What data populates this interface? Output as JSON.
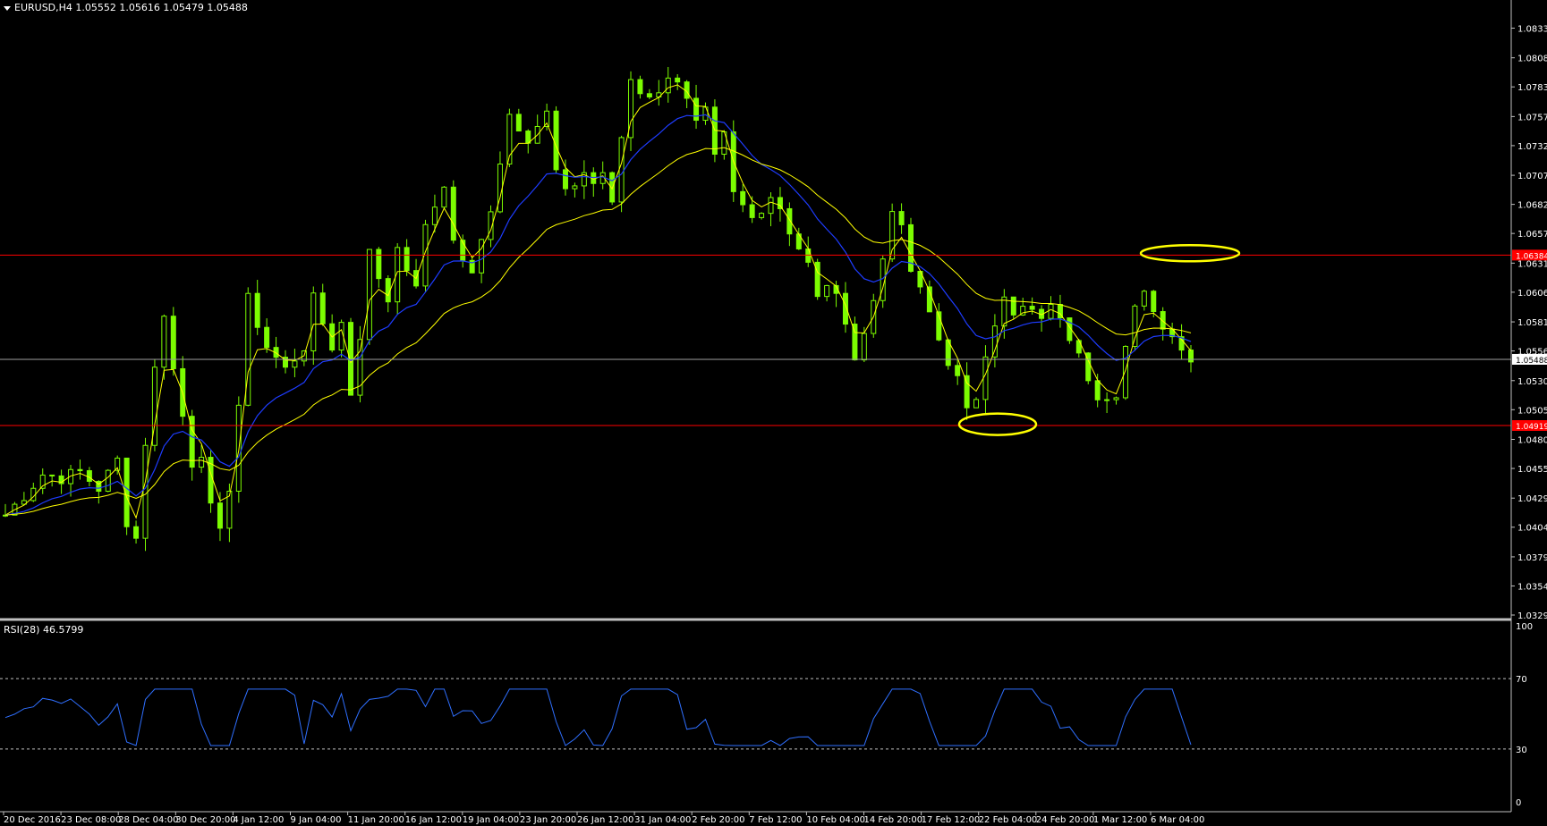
{
  "header": {
    "symbol": "EURUSD,H4",
    "open": "1.05552",
    "high": "1.05616",
    "low": "1.05479",
    "close": "1.05488"
  },
  "rsi_label": "RSI(28) 46.5799",
  "colors": {
    "background": "#000000",
    "candles": "#7cfc00",
    "ma_fast": "#ffff00",
    "ma_mid": "#1e3cff",
    "ma_slow": "#ffff00",
    "hline": "#ff0000",
    "price_line": "#a0a0a0",
    "rsi": "#2f6fff",
    "ellipse": "#ffff00"
  },
  "chart_data": [
    {
      "type": "candlestick",
      "title": "EURUSD,H4",
      "ylim": [
        1.0329,
        1.085
      ],
      "y_ticks": [
        "1.08335",
        "1.08080",
        "1.07830",
        "1.07575",
        "1.07325",
        "1.07070",
        "1.06820",
        "1.06570",
        "1.06315",
        "1.06065",
        "1.05810",
        "1.05560",
        "1.05305",
        "1.05055",
        "1.04800",
        "1.04550",
        "1.04295",
        "1.04045",
        "1.03790",
        "1.03540",
        "1.03290"
      ],
      "x_ticks": [
        "20 Dec 2016",
        "23 Dec 08:00",
        "28 Dec 04:00",
        "30 Dec 20:00",
        "4 Jan 12:00",
        "9 Jan 04:00",
        "11 Jan 20:00",
        "16 Jan 12:00",
        "19 Jan 04:00",
        "23 Jan 20:00",
        "26 Jan 12:00",
        "31 Jan 04:00",
        "2 Feb 20:00",
        "7 Feb 12:00",
        "10 Feb 04:00",
        "14 Feb 20:00",
        "17 Feb 12:00",
        "22 Feb 04:00",
        "24 Feb 20:00",
        "1 Mar 12:00",
        "6 Mar 04:00"
      ],
      "close_price_label": "1.05488",
      "close_price": 1.05488,
      "horizontal_lines": [
        {
          "value": 1.06384,
          "label": "1.06384"
        },
        {
          "value": 1.04919,
          "label": "1.04919"
        }
      ],
      "close_path": [
        [
          0,
          1.0415
        ],
        [
          2,
          1.0432
        ],
        [
          4,
          1.045
        ],
        [
          6,
          1.0447
        ],
        [
          8,
          1.0452
        ],
        [
          10,
          1.0438
        ],
        [
          12,
          1.0462
        ],
        [
          13,
          1.041
        ],
        [
          14,
          1.0395
        ],
        [
          15,
          1.0478
        ],
        [
          16,
          1.054
        ],
        [
          17,
          1.059
        ],
        [
          18,
          1.054
        ],
        [
          20,
          1.046
        ],
        [
          21,
          1.047
        ],
        [
          22,
          1.042
        ],
        [
          23,
          1.0398
        ],
        [
          24,
          1.044
        ],
        [
          25,
          1.051
        ],
        [
          26,
          1.06
        ],
        [
          28,
          1.056
        ],
        [
          30,
          1.054
        ],
        [
          32,
          1.056
        ],
        [
          33,
          1.06
        ],
        [
          35,
          1.056
        ],
        [
          36,
          1.058
        ],
        [
          37,
          1.052
        ],
        [
          38,
          1.057
        ],
        [
          39,
          1.064
        ],
        [
          41,
          1.06
        ],
        [
          42,
          1.065
        ],
        [
          43,
          1.062
        ],
        [
          44,
          1.0615
        ],
        [
          45,
          1.066
        ],
        [
          47,
          1.07
        ],
        [
          48,
          1.065
        ],
        [
          50,
          1.062
        ],
        [
          52,
          1.068
        ],
        [
          53,
          1.072
        ],
        [
          54,
          1.076
        ],
        [
          56,
          1.074
        ],
        [
          57,
          1.075
        ],
        [
          58,
          1.076
        ],
        [
          59,
          1.071
        ],
        [
          60,
          1.069
        ],
        [
          62,
          1.071
        ],
        [
          63,
          1.07
        ],
        [
          64,
          1.071
        ],
        [
          65,
          1.068
        ],
        [
          66,
          1.074
        ],
        [
          67,
          1.079
        ],
        [
          68,
          1.078
        ],
        [
          70,
          1.0775
        ],
        [
          71,
          1.0795
        ],
        [
          72,
          1.079
        ],
        [
          73,
          1.077
        ],
        [
          74,
          1.075
        ],
        [
          75,
          1.076
        ],
        [
          76,
          1.072
        ],
        [
          77,
          1.074
        ],
        [
          78,
          1.069
        ],
        [
          80,
          1.067
        ],
        [
          82,
          1.069
        ],
        [
          83,
          1.068
        ],
        [
          84,
          1.066
        ],
        [
          85,
          1.0645
        ],
        [
          86,
          1.063
        ],
        [
          87,
          1.06
        ],
        [
          88,
          1.0615
        ],
        [
          90,
          1.0585
        ],
        [
          91,
          1.055
        ],
        [
          92,
          1.057
        ],
        [
          93,
          1.06
        ],
        [
          94,
          1.064
        ],
        [
          95,
          1.067
        ],
        [
          96,
          1.0665
        ],
        [
          97,
          1.062
        ],
        [
          98,
          1.061
        ],
        [
          99,
          1.059
        ],
        [
          100,
          1.057
        ],
        [
          101,
          1.054
        ],
        [
          102,
          1.053
        ],
        [
          103,
          1.051
        ],
        [
          104,
          1.052
        ],
        [
          105,
          1.0555
        ],
        [
          106,
          1.0575
        ],
        [
          107,
          1.06
        ],
        [
          108,
          1.0585
        ],
        [
          109,
          1.059
        ],
        [
          110,
          1.0595
        ],
        [
          111,
          1.058
        ],
        [
          112,
          1.06
        ],
        [
          113,
          1.059
        ],
        [
          114,
          1.057
        ],
        [
          115,
          1.056
        ],
        [
          116,
          1.053
        ],
        [
          117,
          1.051
        ],
        [
          118,
          1.051
        ],
        [
          119,
          1.052
        ],
        [
          120,
          1.056
        ],
        [
          121,
          1.06
        ],
        [
          122,
          1.061
        ],
        [
          123,
          1.059
        ],
        [
          124,
          1.058
        ],
        [
          125,
          1.057
        ],
        [
          126,
          1.056
        ],
        [
          127,
          1.0549
        ]
      ],
      "rsi_ylim": [
        0,
        100
      ],
      "rsi_ticks": [
        100,
        70,
        30,
        0
      ],
      "rsi_levels": [
        70,
        30
      ]
    }
  ],
  "annotations": [
    {
      "shape": "ellipse",
      "near_value": 1.064,
      "at": "upper-right"
    },
    {
      "shape": "ellipse",
      "near_value": 1.0493,
      "at": "lower-center"
    }
  ]
}
